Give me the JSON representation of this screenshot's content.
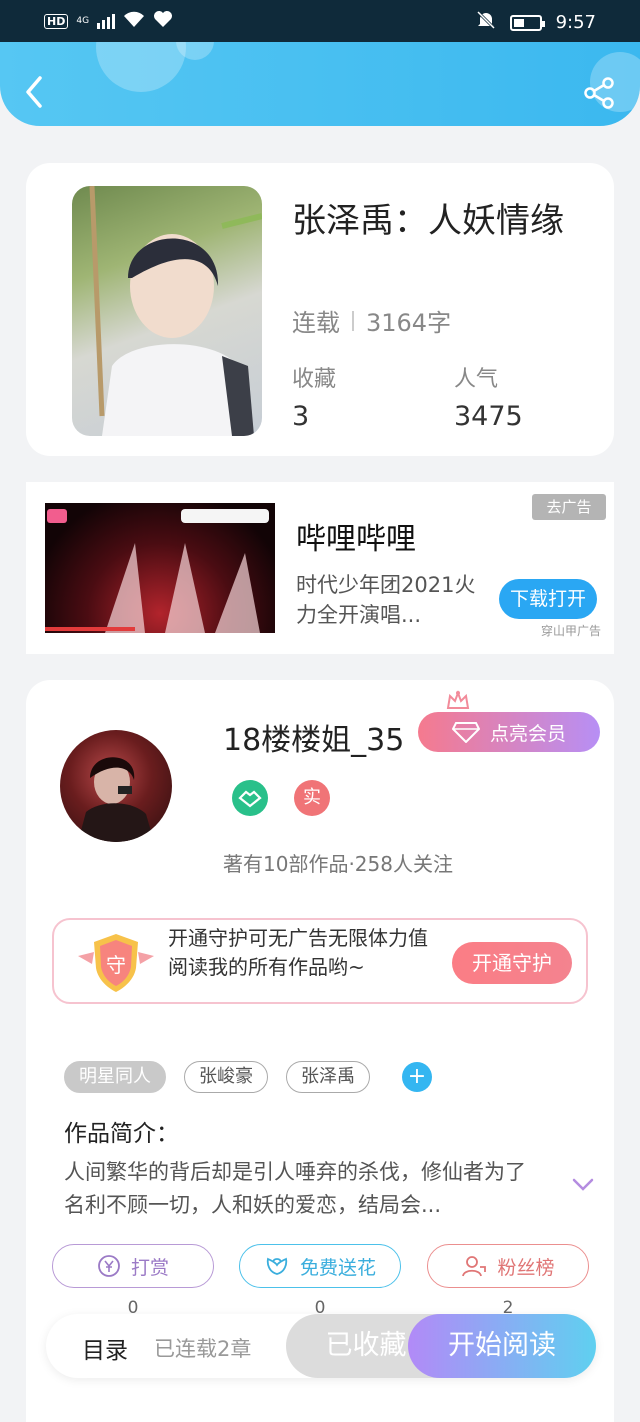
{
  "status": {
    "time": "9:57",
    "hd": "HD",
    "net": "4G"
  },
  "book": {
    "title": "张泽禹：人妖情缘",
    "status": "连载",
    "word_count": "3164字",
    "collect_label": "收藏",
    "collect_value": "3",
    "popularity_label": "人气",
    "popularity_value": "3475"
  },
  "ad": {
    "title": "哔哩哔哩",
    "description": "时代少年团2021火力全开演唱...",
    "remove_label": "去广告",
    "action_label": "下载打开",
    "source": "穿山甲广告"
  },
  "author": {
    "name": "18楼楼姐_35",
    "vip_label": "点亮会员",
    "badge_real": "实",
    "stats": "著有10部作品·258人关注"
  },
  "guard": {
    "icon_text": "守",
    "text": "开通守护可无广告无限体力值阅读我的所有作品哟~",
    "button": "开通守护"
  },
  "tags": [
    "明星同人",
    "张峻豪",
    "张泽禹"
  ],
  "intro": {
    "title": "作品简介：",
    "text": "人间繁华的背后却是引人唾弃的杀伐，修仙者为了名利不顾一切，人和妖的爱恋，结局会..."
  },
  "actions": {
    "tip": {
      "label": "打赏",
      "count": "0"
    },
    "flower": {
      "label": "免费送花",
      "count": "0"
    },
    "fans": {
      "label": "粉丝榜",
      "count": "2"
    }
  },
  "bottom": {
    "catalog": "目录",
    "chapters": "已连载2章",
    "collected": "已收藏",
    "start_read": "开始阅读"
  },
  "colors": {
    "accent": "#3bb8ef",
    "vip_start": "#f57a8e",
    "vip_end": "#b78ff5"
  }
}
